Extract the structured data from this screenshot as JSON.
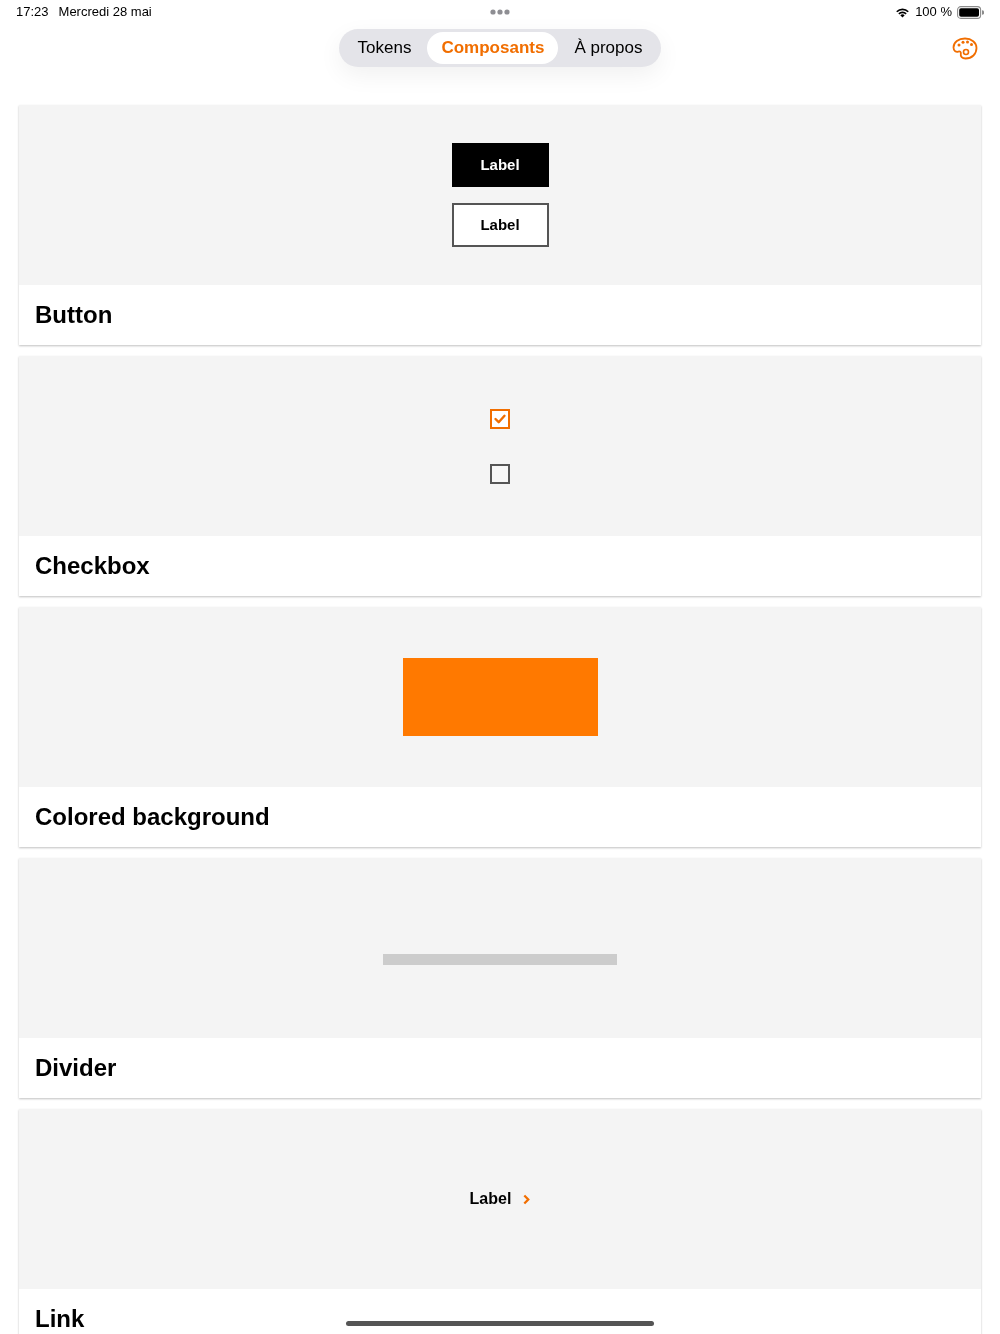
{
  "status_bar": {
    "time": "17:23",
    "date": "Mercredi 28 mai",
    "battery": "100 %"
  },
  "tabs": [
    {
      "label": "Tokens",
      "selected": false
    },
    {
      "label": "Composants",
      "selected": true
    },
    {
      "label": "À propos",
      "selected": false
    }
  ],
  "cards": [
    {
      "title": "Button",
      "kind": "button",
      "buttons": [
        {
          "label": "Label",
          "kind": "filled"
        },
        {
          "label": "Label",
          "kind": "outlined"
        }
      ]
    },
    {
      "title": "Checkbox",
      "kind": "checkbox",
      "checkboxes": [
        {
          "checked": true
        },
        {
          "checked": false
        }
      ]
    },
    {
      "title": "Colored background",
      "kind": "colored_background"
    },
    {
      "title": "Divider",
      "kind": "divider"
    },
    {
      "title": "Link",
      "kind": "link",
      "link": {
        "label": "Label"
      }
    }
  ]
}
